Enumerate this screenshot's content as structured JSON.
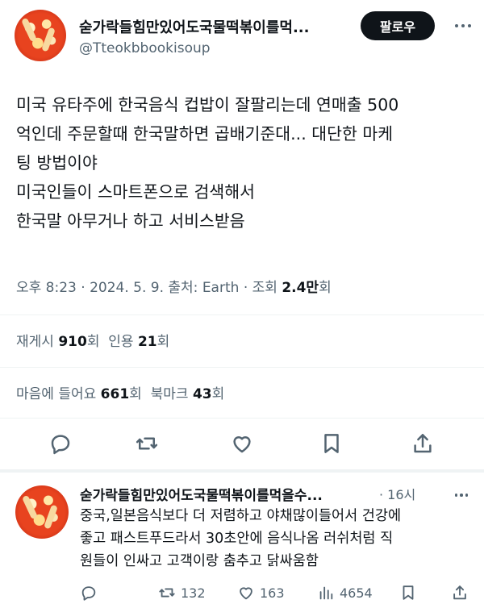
{
  "tweet": {
    "author": {
      "display_name": "숟가락들힘만있어도국물떡볶이를먹...",
      "handle": "@Tteokbbookisoup",
      "avatar_icon": "tteokbokki-avatar"
    },
    "follow_label": "팔로우",
    "more_icon": "more-dots-icon",
    "body_lines": [
      "미국 유타주에 한국음식 컵밥이 잘팔리는데 연매출 500",
      "억인데 주문할때 한국말하면 곱배기준대... 대단한 마케",
      "팅 방법이야",
      "미국인들이 스마트폰으로 검색해서",
      "한국말 아무거나 하고 서비스받음"
    ],
    "meta": {
      "time": "오후 8:23",
      "date": "2024. 5. 9.",
      "source_label": "출처: Earth",
      "views_label": "조회",
      "views_value": "2.4만",
      "views_suffix": "회",
      "sep": "·"
    },
    "stats": {
      "reposts_label": "재게시",
      "reposts_value": "910",
      "quotes_label": "인용",
      "quotes_value": "21",
      "likes_label": "마음에 들어요",
      "likes_value": "661",
      "bookmarks_label": "북마크",
      "bookmarks_value": "43",
      "count_suffix": "회"
    },
    "actions": [
      "reply-icon",
      "repost-icon",
      "like-icon",
      "bookmark-icon",
      "share-icon"
    ]
  },
  "reply": {
    "display_name": "숟가락들힘만있어도국물떡볶이를먹을수...",
    "time": "· 16시",
    "text_lines": [
      "중국,일본음식보다 더 저렴하고 야채많이들어서 건강에",
      "좋고 패스트푸드라서 30초안에 음식나옴 러쉬처럼 직",
      "원들이 인싸고 고객이랑 춤추고 닭싸움함"
    ],
    "counts": {
      "reposts": "132",
      "likes": "163",
      "views": "4654"
    }
  },
  "colors": {
    "text_primary": "#0f1419",
    "text_secondary": "#536471",
    "divider": "#eff3f4",
    "follow_bg": "#0f1419"
  }
}
